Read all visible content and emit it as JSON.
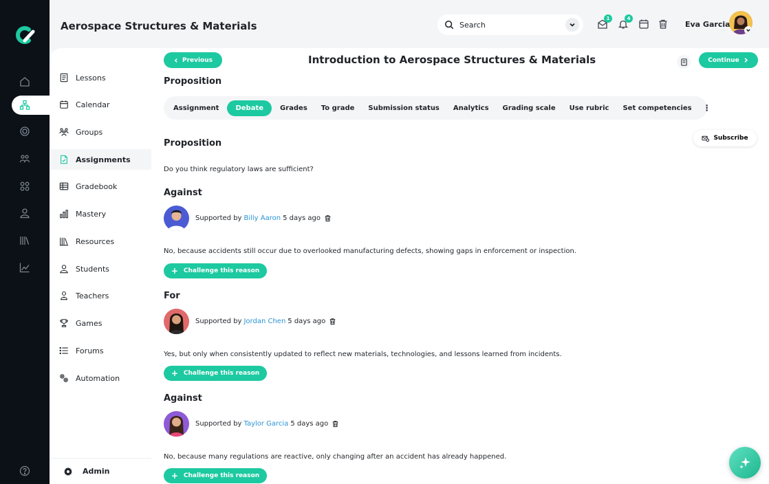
{
  "app": {
    "logo_icon": "brand-logo-icon"
  },
  "header": {
    "course_title": "Aerospace Structures & Materials",
    "search_placeholder": "Search",
    "messages_badge": "1",
    "notifications_badge": "4",
    "user_name": "Eva Garcia"
  },
  "sidebar": {
    "items": [
      {
        "label": "Lessons",
        "icon": "lessons-icon"
      },
      {
        "label": "Calendar",
        "icon": "calendar-icon"
      },
      {
        "label": "Groups",
        "icon": "groups-icon"
      },
      {
        "label": "Assignments",
        "icon": "assignments-icon",
        "active": true
      },
      {
        "label": "Gradebook",
        "icon": "gradebook-icon"
      },
      {
        "label": "Mastery",
        "icon": "mastery-icon"
      },
      {
        "label": "Resources",
        "icon": "resources-icon"
      },
      {
        "label": "Students",
        "icon": "students-icon"
      },
      {
        "label": "Teachers",
        "icon": "teachers-icon"
      },
      {
        "label": "Games",
        "icon": "games-icon"
      },
      {
        "label": "Forums",
        "icon": "forums-icon"
      },
      {
        "label": "Automation",
        "icon": "automation-icon"
      }
    ],
    "admin_label": "Admin"
  },
  "main": {
    "previous_label": "Previous",
    "lesson_title": "Introduction to Aerospace Structures & Materials",
    "continue_label": "Continue",
    "sub_heading": "Proposition",
    "tabs": [
      {
        "label": "Assignment"
      },
      {
        "label": "Debate",
        "active": true
      },
      {
        "label": "Grades"
      },
      {
        "label": "To grade"
      },
      {
        "label": "Submission status"
      },
      {
        "label": "Analytics"
      },
      {
        "label": "Grading scale"
      },
      {
        "label": "Use rubric"
      },
      {
        "label": "Set competencies"
      }
    ],
    "subscribe_label": "Subscribe",
    "proposition_heading": "Proposition",
    "question": "Do you think regulatory laws are sufficient?",
    "challenge_label": "Challenge this reason",
    "supported_by": "Supported by",
    "arguments": [
      {
        "side": "Against",
        "author": "Billy Aaron",
        "time": "5 days ago",
        "text": "No, because accidents still occur due to overlooked manufacturing defects, showing gaps in enforcement or inspection."
      },
      {
        "side": "For",
        "author": "Jordan Chen",
        "time": "5 days ago",
        "text": "Yes, but only when consistently updated to reflect new materials, technologies, and lessons learned from incidents."
      },
      {
        "side": "Against",
        "author": "Taylor Garcia",
        "time": "5 days ago",
        "text": "No, because many regulations are reactive, only changing after an accident has already happened."
      }
    ]
  },
  "colors": {
    "accent": "#1dc9a0",
    "link": "#2a93d5",
    "rail": "#0c1117"
  }
}
